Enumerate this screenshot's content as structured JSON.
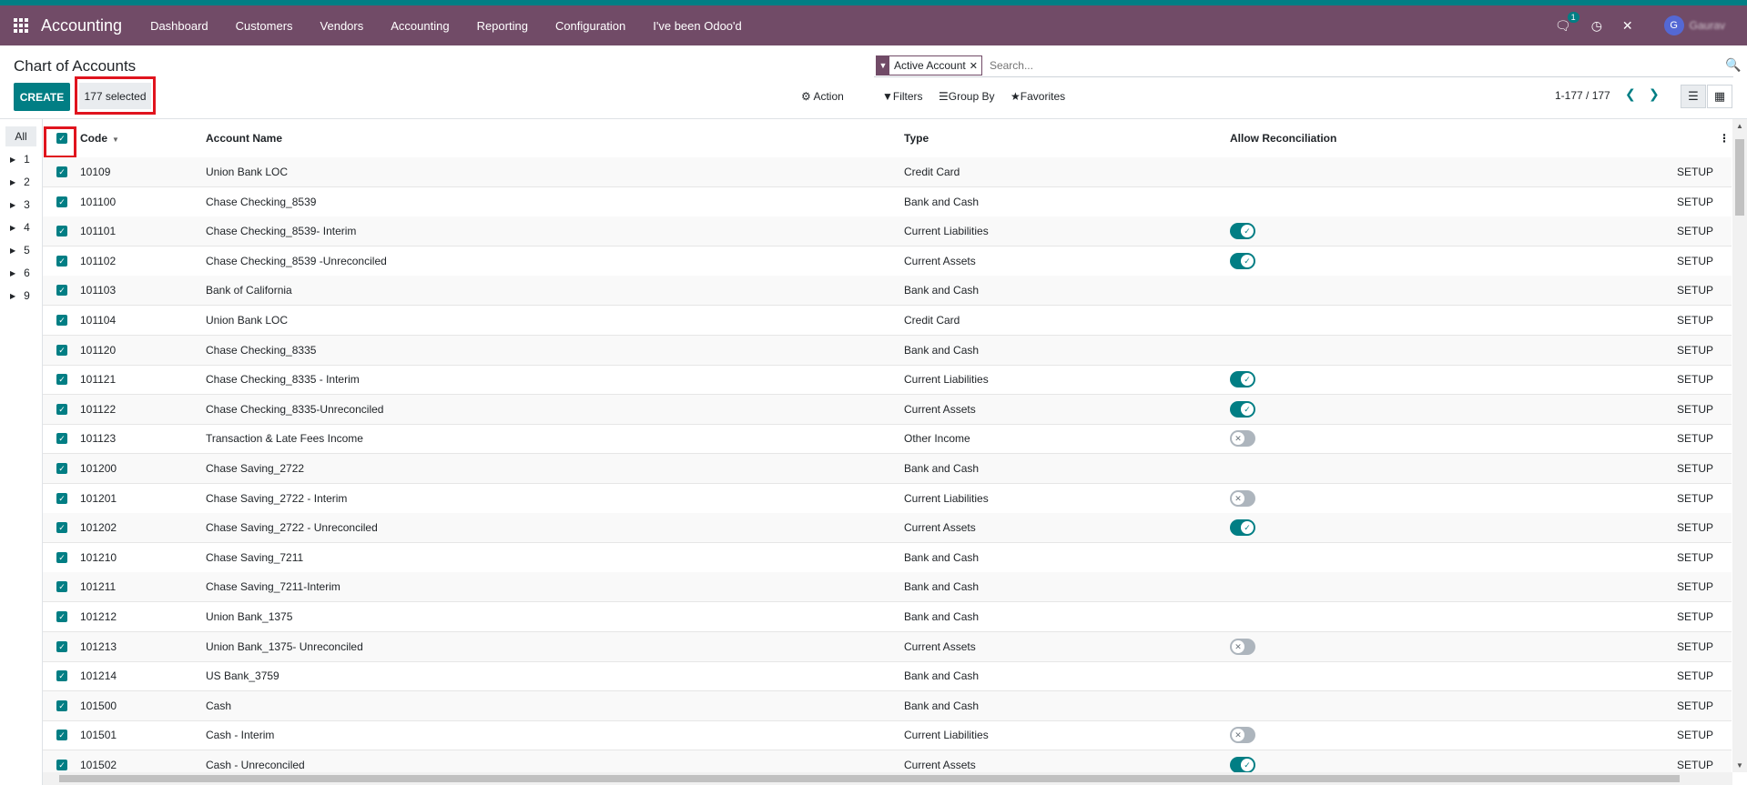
{
  "navbar": {
    "brand": "Accounting",
    "menu": [
      "Dashboard",
      "Customers",
      "Vendors",
      "Accounting",
      "Reporting",
      "Configuration",
      "I've been Odoo'd"
    ],
    "chat_badge": "1",
    "user_initial": "G",
    "user_name": "Gaurav"
  },
  "page": {
    "title": "Chart of Accounts"
  },
  "search": {
    "facet": "Active Account",
    "placeholder": "Search..."
  },
  "controls": {
    "create_label": "CREATE",
    "selected_label": "177 selected",
    "action": "Action",
    "filters": "Filters",
    "group_by": "Group By",
    "favorites": "Favorites",
    "pager": "1-177 / 177"
  },
  "sidebar": {
    "all": "All",
    "items": [
      "1",
      "2",
      "3",
      "4",
      "5",
      "6",
      "9"
    ]
  },
  "table": {
    "headers": {
      "code": "Code",
      "name": "Account Name",
      "type": "Type",
      "reconcile": "Allow Reconciliation"
    },
    "setup_label": "SETUP",
    "rows": [
      {
        "code": "10109",
        "name": "Union Bank LOC",
        "type": "Credit Card",
        "toggle": null
      },
      {
        "code": "101100",
        "name": "Chase Checking_8539",
        "type": "Bank and Cash",
        "toggle": null
      },
      {
        "code": "101101",
        "name": "Chase Checking_8539- Interim",
        "type": "Current Liabilities",
        "toggle": "on"
      },
      {
        "code": "101102",
        "name": "Chase Checking_8539 -Unreconciled",
        "type": "Current Assets",
        "toggle": "on"
      },
      {
        "code": "101103",
        "name": "Bank of California",
        "type": "Bank and Cash",
        "toggle": null
      },
      {
        "code": "101104",
        "name": "Union Bank LOC",
        "type": "Credit Card",
        "toggle": null
      },
      {
        "code": "101120",
        "name": "Chase Checking_8335",
        "type": "Bank and Cash",
        "toggle": null
      },
      {
        "code": "101121",
        "name": "Chase Checking_8335 - Interim",
        "type": "Current Liabilities",
        "toggle": "on"
      },
      {
        "code": "101122",
        "name": "Chase Checking_8335-Unreconciled",
        "type": "Current Assets",
        "toggle": "on"
      },
      {
        "code": "101123",
        "name": "Transaction & Late Fees Income",
        "type": "Other Income",
        "toggle": "off"
      },
      {
        "code": "101200",
        "name": "Chase Saving_2722",
        "type": "Bank and Cash",
        "toggle": null
      },
      {
        "code": "101201",
        "name": "Chase Saving_2722 - Interim",
        "type": "Current Liabilities",
        "toggle": "off"
      },
      {
        "code": "101202",
        "name": "Chase Saving_2722 - Unreconciled",
        "type": "Current Assets",
        "toggle": "on"
      },
      {
        "code": "101210",
        "name": "Chase Saving_7211",
        "type": "Bank and Cash",
        "toggle": null
      },
      {
        "code": "101211",
        "name": "Chase Saving_7211-Interim",
        "type": "Bank and Cash",
        "toggle": null
      },
      {
        "code": "101212",
        "name": "Union Bank_1375",
        "type": "Bank and Cash",
        "toggle": null
      },
      {
        "code": "101213",
        "name": "Union Bank_1375- Unreconciled",
        "type": "Current Assets",
        "toggle": "off"
      },
      {
        "code": "101214",
        "name": "US Bank_3759",
        "type": "Bank and Cash",
        "toggle": null
      },
      {
        "code": "101500",
        "name": "Cash",
        "type": "Bank and Cash",
        "toggle": null
      },
      {
        "code": "101501",
        "name": "Cash - Interim",
        "type": "Current Liabilities",
        "toggle": "off"
      },
      {
        "code": "101502",
        "name": "Cash - Unreconciled",
        "type": "Current Assets",
        "toggle": "on"
      }
    ]
  },
  "colors": {
    "brand": "#714b67",
    "accent": "#017e84",
    "highlight": "#e0141e"
  }
}
